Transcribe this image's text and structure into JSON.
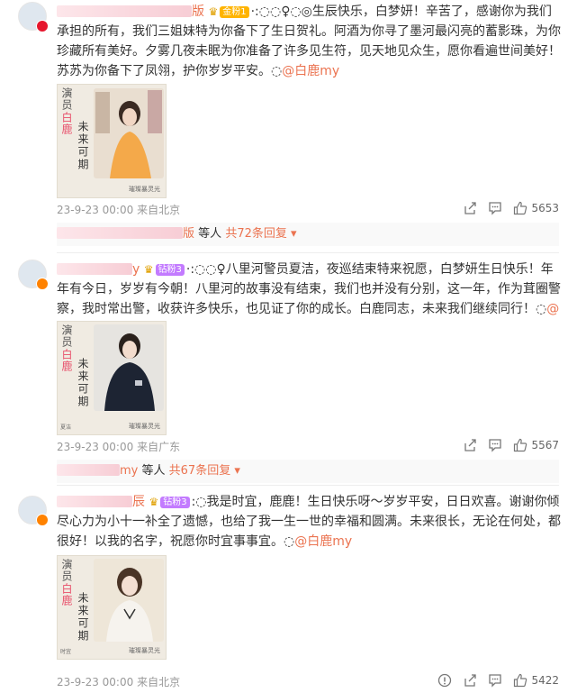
{
  "comments": [
    {
      "user_name_suffix": "版",
      "fan_badge": "金粉1",
      "text": "·:◌◌♀◌◎生辰快乐，白梦妍！辛苦了，感谢你为我们承担的所有，我们三姐妹特为你备下了生日贺礼。阿酒为你寻了墨河最闪亮的蓄影珠，为你珍藏所有美好。夕雾几夜未眠为你准备了许多见生符，见天地见众生，愿你看遍世间美好！苏苏为你备下了凤翎，护你岁岁平安。◌",
      "mention": "@白鹿my",
      "poster": {
        "role": "演员",
        "star": "白鹿",
        "title": "未来可期",
        "name": "",
        "footer": "璀璨暴灵光"
      },
      "date": "23-9-23 00:00",
      "source": "来自北京",
      "likes": "5653",
      "replies": {
        "users_suffix": "版",
        "etc": "等人",
        "count_label": "共72条回复"
      }
    },
    {
      "user_name_suffix": "y",
      "fan_badge": "钻粉3",
      "text": "·:◌◌♀八里河警员夏洁，夜巡结束特来祝愿，白梦妍生日快乐！年年有今日，岁岁有今朝！八里河的故事没有结束，我们也并没有分别，这一年，作为茸圈警察，我时常出警，收获许多快乐，也见证了你的成长。白鹿同志，未来我们继续同行！◌",
      "mention": "@白鹿my",
      "poster": {
        "role": "演员",
        "star": "白鹿",
        "title": "未来可期",
        "name": "夏洁",
        "footer": "璀璨暴灵光"
      },
      "date": "23-9-23 00:00",
      "source": "来自广东",
      "likes": "5567",
      "replies": {
        "users_suffix": "my",
        "etc": "等人",
        "count_label": "共67条回复"
      }
    },
    {
      "user_name_suffix": "辰",
      "fan_badge": "钻粉3",
      "text": ":◌我是时宜，鹿鹿！生日快乐呀～岁岁平安，日日欢喜。谢谢你倾尽心力为小十一补全了遗憾，也给了我一生一世的幸福和圆满。未来很长，无论在何处，都很好！以我的名字，祝愿你时宜事事宜。◌",
      "mention": "@白鹿my",
      "poster": {
        "role": "演员",
        "star": "白鹿",
        "title": "未来可期",
        "name": "时宜",
        "footer": "璀璨暴灵光"
      },
      "date": "23-9-23 00:00",
      "source": "来自北京",
      "likes": "5422"
    }
  ],
  "colors": {
    "accent": "#eb7350",
    "meta": "#999999",
    "divider": "#eeeeee"
  }
}
